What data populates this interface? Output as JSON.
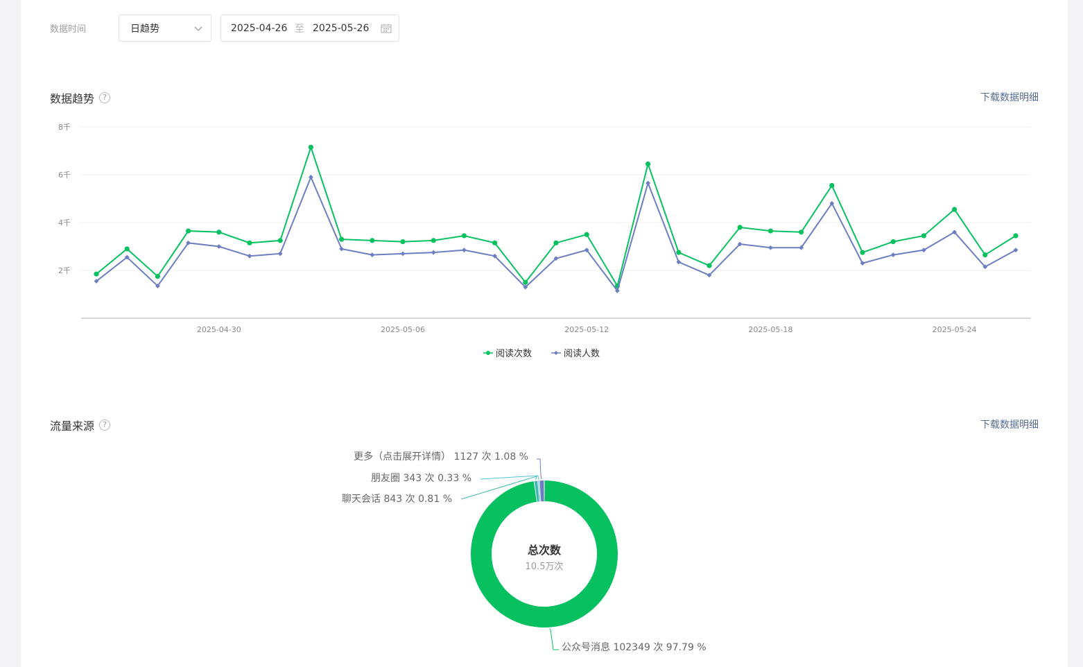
{
  "filter": {
    "label": "数据时间",
    "mode_value": "日趋势",
    "start_date": "2025-04-26",
    "range_separator": "至",
    "end_date": "2025-05-26"
  },
  "trend": {
    "title": "数据趋势",
    "help_glyph": "?",
    "download_label": "下载数据明细"
  },
  "source": {
    "title": "流量来源",
    "help_glyph": "?",
    "download_label": "下载数据明细"
  },
  "chart_data": [
    {
      "type": "line",
      "ylim": [
        0,
        8000
      ],
      "y_ticks": [
        {
          "value": 2000,
          "label": "2千"
        },
        {
          "value": 4000,
          "label": "4千"
        },
        {
          "value": 6000,
          "label": "6千"
        },
        {
          "value": 8000,
          "label": "8千"
        }
      ],
      "x": [
        "2025-04-26",
        "2025-04-27",
        "2025-04-28",
        "2025-04-29",
        "2025-04-30",
        "2025-05-01",
        "2025-05-02",
        "2025-05-03",
        "2025-05-04",
        "2025-05-05",
        "2025-05-06",
        "2025-05-07",
        "2025-05-08",
        "2025-05-09",
        "2025-05-10",
        "2025-05-11",
        "2025-05-12",
        "2025-05-13",
        "2025-05-14",
        "2025-05-15",
        "2025-05-16",
        "2025-05-17",
        "2025-05-18",
        "2025-05-19",
        "2025-05-20",
        "2025-05-21",
        "2025-05-22",
        "2025-05-23",
        "2025-05-24",
        "2025-05-25",
        "2025-05-26",
        "2025-05-27"
      ],
      "x_tick_labels": [
        "2025-04-30",
        "2025-05-06",
        "2025-05-12",
        "2025-05-18",
        "2025-05-24"
      ],
      "grid": true,
      "legend": "bottom-center",
      "series": [
        {
          "name": "阅读次数",
          "color": "#07c160",
          "marker": "circle",
          "values": [
            1850,
            2900,
            1750,
            3650,
            3600,
            3150,
            3250,
            7150,
            3300,
            3250,
            3200,
            3250,
            3450,
            3150,
            1500,
            3150,
            3500,
            1350,
            6450,
            2750,
            2200,
            3800,
            3650,
            3600,
            5550,
            2750,
            3200,
            3450,
            4550,
            2650,
            3450,
            null
          ]
        },
        {
          "name": "阅读人数",
          "color": "#6c7dc2",
          "marker": "diamond",
          "values": [
            1550,
            2550,
            1350,
            3150,
            3000,
            2600,
            2700,
            5900,
            2900,
            2650,
            2700,
            2750,
            2850,
            2600,
            1300,
            2500,
            2850,
            1150,
            5650,
            2350,
            1800,
            3100,
            2950,
            2950,
            4800,
            2300,
            2650,
            2850,
            3600,
            2150,
            2850,
            null
          ]
        }
      ]
    },
    {
      "type": "pie",
      "center_title": "总次数",
      "center_value": "10.5万次",
      "slices": [
        {
          "name": "公众号消息",
          "count": 102349,
          "unit": "次",
          "percent": 97.79,
          "label": "公众号消息 102349 次 97.79 %",
          "color": "#07c160"
        },
        {
          "name": "聊天会话",
          "count": 843,
          "unit": "次",
          "percent": 0.81,
          "label": "聊天会话 843 次 0.81 %",
          "color": "#3fb9b0"
        },
        {
          "name": "朋友圈",
          "count": 343,
          "unit": "次",
          "percent": 0.33,
          "label": "朋友圈 343 次 0.33 %",
          "color": "#4fc3d6"
        },
        {
          "name": "更多（点击展开详情）",
          "count": 1127,
          "unit": "次",
          "percent": 1.08,
          "label": "更多（点击展开详情） 1127 次 1.08 %",
          "color": "#6c7dc2"
        }
      ]
    }
  ]
}
